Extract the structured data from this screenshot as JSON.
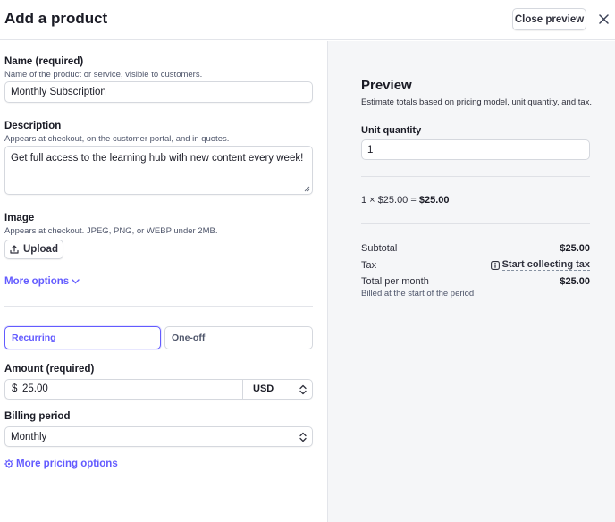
{
  "header": {
    "title": "Add a product",
    "close_preview_label": "Close preview",
    "close_icon": "×"
  },
  "form": {
    "name": {
      "label": "Name (required)",
      "hint": "Name of the product or service, visible to customers.",
      "value": "Monthly Subscription"
    },
    "description": {
      "label": "Description",
      "hint": "Appears at checkout, on the customer portal, and in quotes.",
      "value": "Get full access to the learning hub with new content every week!"
    },
    "image": {
      "label": "Image",
      "hint": "Appears at checkout. JPEG, PNG, or WEBP under 2MB.",
      "upload_label": "Upload"
    },
    "more_options_label": "More options",
    "pricing_type": {
      "recurring_label": "Recurring",
      "one_off_label": "One-off",
      "selected": "Recurring"
    },
    "amount": {
      "label": "Amount (required)",
      "currency_symbol": "$",
      "value": "25.00",
      "currency": "USD"
    },
    "billing_period": {
      "label": "Billing period",
      "value": "Monthly"
    },
    "more_pricing_options_label": "More pricing options"
  },
  "preview": {
    "title": "Preview",
    "subtitle": "Estimate totals based on pricing model, unit quantity, and tax.",
    "unit_quantity_label": "Unit quantity",
    "unit_quantity_value": "1",
    "calculation_prefix": "1 × $25.00 = ",
    "calculation_result": "$25.00",
    "subtotal_label": "Subtotal",
    "subtotal_value": "$25.00",
    "tax_label": "Tax",
    "tax_link_label": "Start collecting tax",
    "total_label": "Total per month",
    "total_value": "$25.00",
    "billed_note": "Billed at the start of the period"
  },
  "colors": {
    "accent": "#635bff",
    "text": "#1a1b25",
    "border": "#d5d8de",
    "preview_bg": "#f5f6f8"
  }
}
